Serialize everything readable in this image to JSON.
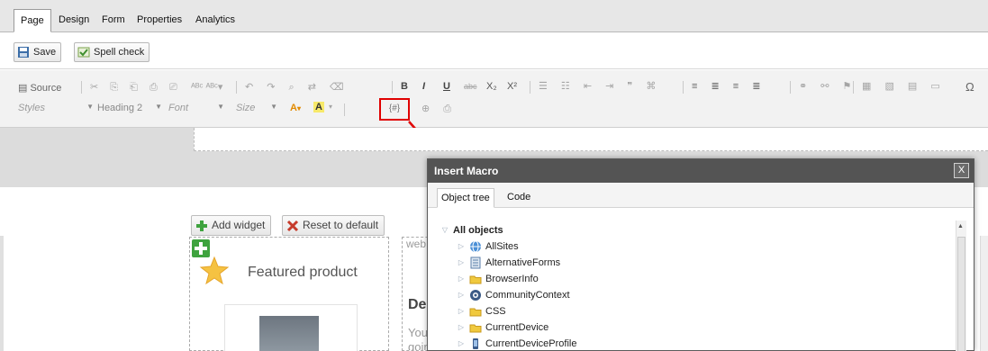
{
  "tabs": [
    {
      "label": "Page",
      "active": true
    },
    {
      "label": "Design",
      "active": false
    },
    {
      "label": "Form",
      "active": false
    },
    {
      "label": "Properties",
      "active": false
    },
    {
      "label": "Analytics",
      "active": false
    }
  ],
  "actions": {
    "save": "Save",
    "spell_check": "Spell check"
  },
  "editor": {
    "source": "Source",
    "styles": "Styles",
    "heading": "Heading 2",
    "font": "Font",
    "size": "Size",
    "macro_button": "{#}",
    "bold": "B",
    "italic": "I",
    "underline": "U",
    "strike": "abc",
    "subscript": "X₂",
    "superscript": "X²",
    "omega": "Ω"
  },
  "widgets": {
    "add": "Add widget",
    "reset": "Reset to default",
    "featured": "Featured product",
    "web_text": "web",
    "heading_partial": "De",
    "you_text": "You",
    "goin_text": "goin"
  },
  "dialog": {
    "title": "Insert Macro",
    "close": "X",
    "tabs": [
      "Object tree",
      "Code"
    ],
    "root": "All objects",
    "items": [
      {
        "label": "AllSites",
        "icon": "globe-icon"
      },
      {
        "label": "AlternativeForms",
        "icon": "form-icon"
      },
      {
        "label": "BrowserInfo",
        "icon": "folder-icon"
      },
      {
        "label": "CommunityContext",
        "icon": "community-icon"
      },
      {
        "label": "CSS",
        "icon": "folder-icon"
      },
      {
        "label": "CurrentDevice",
        "icon": "folder-icon"
      },
      {
        "label": "CurrentDeviceProfile",
        "icon": "device-icon"
      }
    ]
  },
  "colors": {
    "highlight": "#e00000",
    "dialog_title": "#545454",
    "plus_green": "#3fa33f",
    "reset_red": "#c63b2b"
  }
}
